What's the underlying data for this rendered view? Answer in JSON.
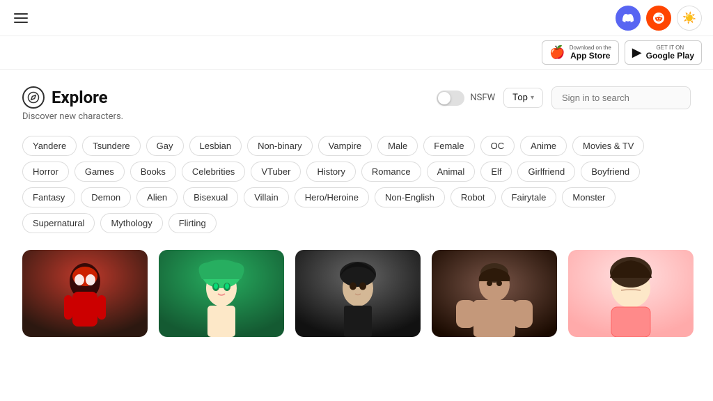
{
  "nav": {
    "discord_label": "Discord",
    "reddit_label": "Reddit",
    "theme_icon": "☀",
    "hamburger_label": "Menu"
  },
  "appstore": {
    "apple_pre": "Download on the",
    "apple_main": "App Store",
    "google_pre": "GET IT ON",
    "google_main": "Google Play"
  },
  "explore": {
    "title": "Explore",
    "subtitle": "Discover new characters.",
    "nsfw_label": "NSFW",
    "sort_label": "Top",
    "search_placeholder": "Sign in to search"
  },
  "tags": [
    "Yandere",
    "Tsundere",
    "Gay",
    "Lesbian",
    "Non-binary",
    "Vampire",
    "Male",
    "Female",
    "OC",
    "Anime",
    "Movies & TV",
    "Horror",
    "Games",
    "Books",
    "Celebrities",
    "VTuber",
    "History",
    "Romance",
    "Animal",
    "Elf",
    "Girlfriend",
    "Boyfriend",
    "Fantasy",
    "Demon",
    "Alien",
    "Bisexual",
    "Villain",
    "Hero/Heroine",
    "Non-English",
    "Robot",
    "Fairytale",
    "Monster",
    "Supernatural",
    "Mythology",
    "Flirting"
  ],
  "characters": [
    {
      "id": 1,
      "name": "Spider character",
      "style": "char-1"
    },
    {
      "id": 2,
      "name": "Green hair character",
      "style": "char-2"
    },
    {
      "id": 3,
      "name": "Dark hair character",
      "style": "char-3"
    },
    {
      "id": 4,
      "name": "Muscular character",
      "style": "char-4"
    },
    {
      "id": 5,
      "name": "Pink shirt character",
      "style": "char-5"
    }
  ]
}
